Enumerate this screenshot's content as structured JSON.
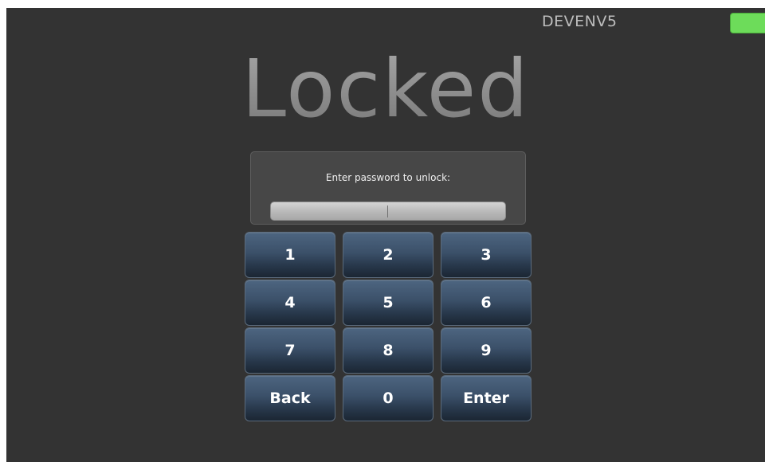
{
  "header": {
    "device_name": "DEVENV5",
    "status_color": "#6ddc5a"
  },
  "lock_screen": {
    "title": "Locked",
    "prompt": "Enter password to unlock:",
    "password_value": ""
  },
  "keypad": {
    "keys": [
      "1",
      "2",
      "3",
      "4",
      "5",
      "6",
      "7",
      "8",
      "9",
      "Back",
      "0",
      "Enter"
    ]
  },
  "colors": {
    "background": "#333333",
    "key_top": "#4d6580",
    "key_bottom": "#1b2633",
    "title_text": "#8e8e8e"
  }
}
